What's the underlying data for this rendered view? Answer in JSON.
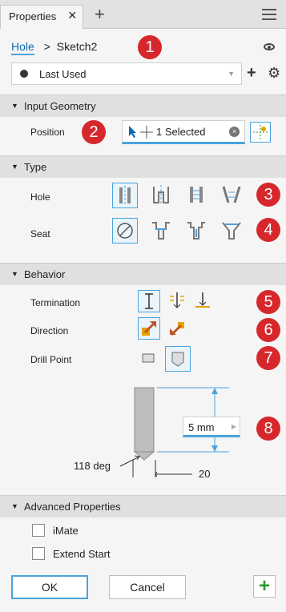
{
  "tab": {
    "title": "Properties"
  },
  "breadcrumb": {
    "feature": "Hole",
    "separator": ">",
    "sketch": "Sketch2"
  },
  "preset": {
    "value": "Last Used"
  },
  "sections": {
    "input_geometry": "Input Geometry",
    "type": "Type",
    "behavior": "Behavior",
    "advanced": "Advanced Properties"
  },
  "input_geometry": {
    "position_label": "Position",
    "position_value": "1 Selected"
  },
  "type": {
    "hole_label": "Hole",
    "seat_label": "Seat"
  },
  "behavior": {
    "termination_label": "Termination",
    "direction_label": "Direction",
    "drill_point_label": "Drill Point",
    "dimension_value": "5 mm",
    "angle_label": "118 deg",
    "diameter_label": "20"
  },
  "advanced": {
    "imate_label": "iMate",
    "extend_start_label": "Extend Start"
  },
  "buttons": {
    "ok": "OK",
    "cancel": "Cancel"
  },
  "badges": [
    "1",
    "2",
    "3",
    "4",
    "5",
    "6",
    "7",
    "8"
  ],
  "colors": {
    "accent": "#4aa3df",
    "badge": "#d6282c",
    "link": "#0b68b4"
  }
}
